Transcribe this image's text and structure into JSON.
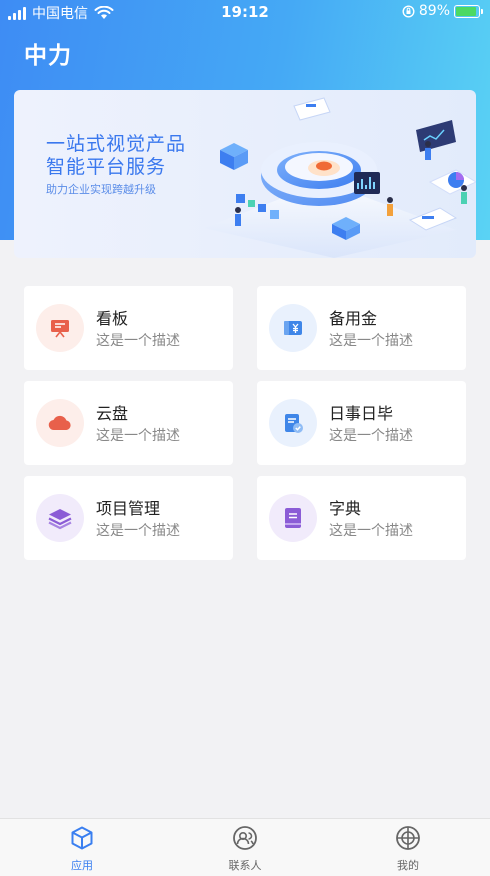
{
  "status_bar": {
    "carrier": "中国电信",
    "time": "19:12",
    "battery_percent": "89%",
    "battery_level": 0.89
  },
  "header": {
    "title": "中力"
  },
  "banner": {
    "headline_1": "一站式视觉产品",
    "headline_2": "智能平台服务",
    "subtitle": "助力企业实现跨越升级"
  },
  "cards": [
    {
      "title": "看板",
      "desc": "这是一个描述",
      "icon": "presentation-board-icon",
      "color": "#e8604b",
      "bg": "#fdeeea"
    },
    {
      "title": "备用金",
      "desc": "这是一个描述",
      "icon": "yuan-wallet-icon",
      "color": "#3f86e8",
      "bg": "#e9f1fd"
    },
    {
      "title": "云盘",
      "desc": "这是一个描述",
      "icon": "cloud-icon",
      "color": "#e8604b",
      "bg": "#fdeeea"
    },
    {
      "title": "日事日毕",
      "desc": "这是一个描述",
      "icon": "task-checklist-icon",
      "color": "#3f86e8",
      "bg": "#e9f1fd"
    },
    {
      "title": "项目管理",
      "desc": "这是一个描述",
      "icon": "layers-icon",
      "color": "#8b5cd6",
      "bg": "#f1ebfb"
    },
    {
      "title": "字典",
      "desc": "这是一个描述",
      "icon": "book-icon",
      "color": "#8b5cd6",
      "bg": "#f1ebfb"
    }
  ],
  "tabbar": {
    "tabs": [
      {
        "label": "应用",
        "icon": "cube-icon",
        "active": true
      },
      {
        "label": "联系人",
        "icon": "contacts-icon",
        "active": false
      },
      {
        "label": "我的",
        "icon": "crosshair-icon",
        "active": false
      }
    ]
  },
  "colors": {
    "accent": "#3a7ff0",
    "header_gradient_start": "#3e8cf4",
    "header_gradient_end": "#5ad3f4"
  }
}
